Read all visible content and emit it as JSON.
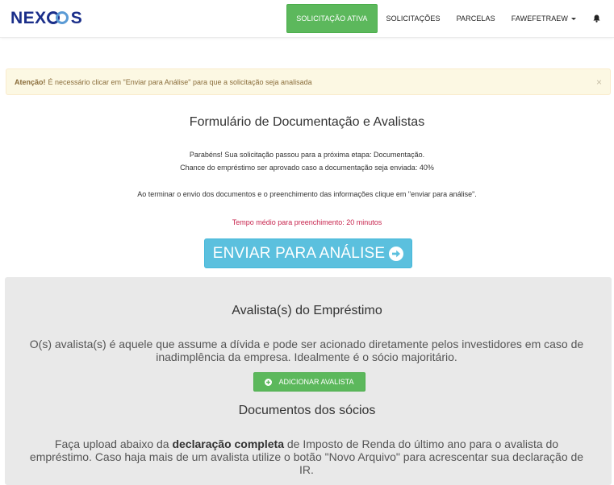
{
  "brand": {
    "logo_text_left": "NEX",
    "logo_text_right": "S"
  },
  "nav": {
    "items": [
      {
        "label": "SOLICITAÇÃO ATIVA"
      },
      {
        "label": "SOLICITAÇÕES"
      },
      {
        "label": "PARCELAS"
      },
      {
        "label": "FAWEFETRAEW"
      }
    ],
    "bell_icon": "bell-icon"
  },
  "alert": {
    "strong": "Atenção!",
    "text": "É necessário clicar em \"Enviar para Análise\" para que a solicitação seja analisada",
    "close": "×"
  },
  "form": {
    "title": "Formulário de Documentação e Avalistas",
    "line1": "Parabéns! Sua solicitação passou para a próxima etapa: Documentação.",
    "line2": "Chance do empréstimo ser aprovado caso a documentação seja enviada: 40%",
    "line3": "Ao terminar o envio dos documentos e o preenchimento das informações clique em \"enviar para análise\".",
    "time_note": "Tempo médio para preenchimento: 20 minutos",
    "send_button": "ENVIAR PARA ANÁLISE"
  },
  "guarantors": {
    "title": "Avalista(s) do Empréstimo",
    "description": "O(s) avalista(s) é aquele que assume a dívida e pode ser acionado diretamente pelos investidores em caso de inadimplência da empresa. Idealmente é o sócio majoritário.",
    "add_button": "ADICIONAR AVALISTA"
  },
  "documents": {
    "title": "Documentos dos sócios",
    "text_before": "Faça upload abaixo da ",
    "text_bold": "declaração completa",
    "text_after": " de Imposto de Renda do último ano para o avalista do empréstimo. Caso haja mais de um avalista utilize o botão \"Novo Arquivo\" para acrescentar sua declaração de IR."
  },
  "colors": {
    "brand_blue": "#1b2f8a",
    "success": "#5cb85c",
    "info": "#5bc0de",
    "warning_bg": "#fcf8e3"
  }
}
